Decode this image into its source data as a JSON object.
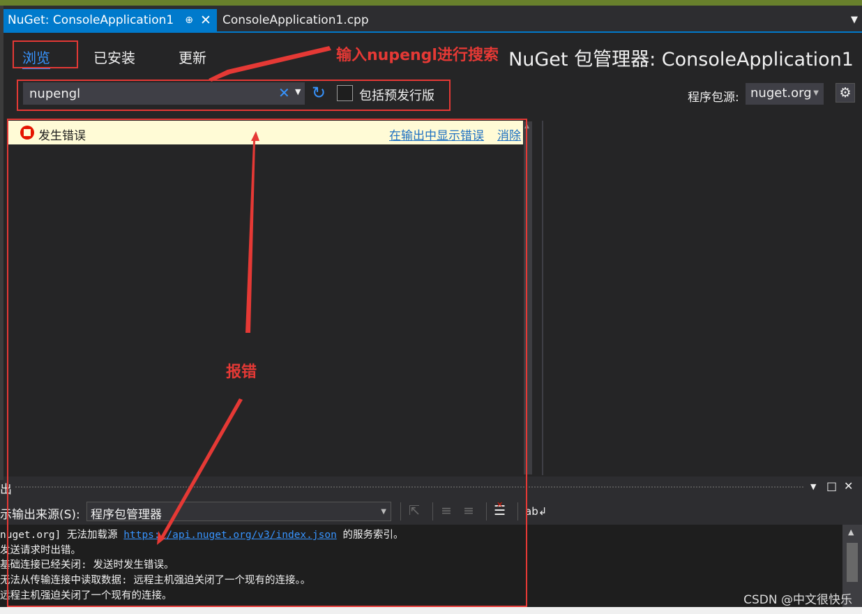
{
  "tabs": [
    {
      "label": "NuGet: ConsoleApplication1",
      "pin": "⊕",
      "close": "✕"
    },
    {
      "label": "ConsoleApplication1.cpp"
    }
  ],
  "tab_dropdown": "▼",
  "nuget": {
    "nav": [
      "浏览",
      "已安装",
      "更新"
    ],
    "title": "NuGet 包管理器: ConsoleApplication1",
    "search_value": "nupengl",
    "clear_glyph": "✕",
    "dropdown_glyph": "▼",
    "refresh_glyph": "↻",
    "prerelease_label": "包括预发行版",
    "source_label": "程序包源:",
    "source_value": "nuget.org",
    "settings_glyph": "⚙"
  },
  "error_bar": {
    "message": "发生错误",
    "show_output_link": "在输出中显示错误",
    "dismiss_link": "消除"
  },
  "output": {
    "title": "出",
    "source_label": "示输出来源(S):",
    "source_value": "程序包管理器",
    "lines": [
      {
        "prefix": "nuget.org] 无法加载源 ",
        "link": "https://api.nuget.org/v3/index.json",
        "suffix": " 的服务索引。"
      },
      {
        "text": "  发送请求时出错。"
      },
      {
        "text": "  基础连接已经关闭: 发送时发生错误。"
      },
      {
        "text": "  无法从传输连接中读取数据: 远程主机强迫关闭了一个现有的连接。。"
      },
      {
        "text": "  远程主机强迫关闭了一个现有的连接。"
      }
    ]
  },
  "annotations": {
    "search_hint": "输入nupengl进行搜索",
    "error_hint": "报错"
  },
  "watermark": "CSDN @中文很快乐",
  "colors": {
    "accent": "#007acc",
    "annotation_red": "#e53935",
    "error_bar_bg": "#fffbd6",
    "link_blue": "#3794ff"
  }
}
